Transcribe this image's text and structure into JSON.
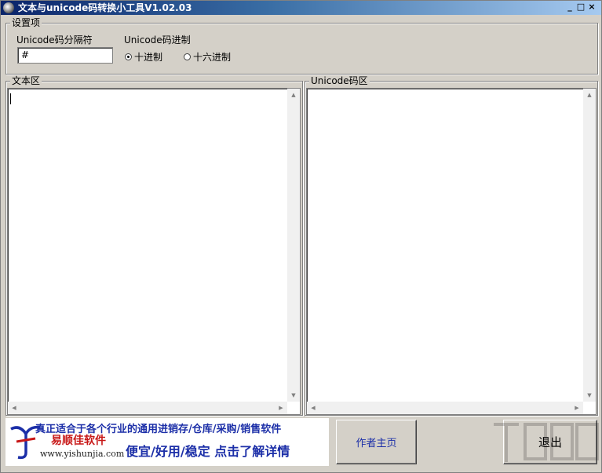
{
  "window": {
    "title": "文本与unicode码转换小工具V1.02.03",
    "minimize_glyph": "_",
    "restore_glyph": "□",
    "close_glyph": "×"
  },
  "settings": {
    "legend": "设置项",
    "separator_label": "Unicode码分隔符",
    "separator_value": "#",
    "radix_label": "Unicode码进制",
    "radix_options": [
      {
        "label": "十进制",
        "checked": true
      },
      {
        "label": "十六进制",
        "checked": false
      }
    ]
  },
  "text_area": {
    "legend": "文本区",
    "content": ""
  },
  "unicode_area": {
    "legend": "Unicode码区",
    "content": ""
  },
  "ad": {
    "line1": "真正适合于各个行业的通用进销存/仓库/采购/销售软件",
    "brand": "易顺佳软件",
    "url": "www.yishunjia.com",
    "slogan": "便宜/好用/稳定 点击了解详情"
  },
  "buttons": {
    "author_home": "作者主页",
    "exit": "退出"
  },
  "colors": {
    "ad_blue": "#1c2fa8",
    "ad_red": "#c81818",
    "title_dark": "#0a246a"
  }
}
